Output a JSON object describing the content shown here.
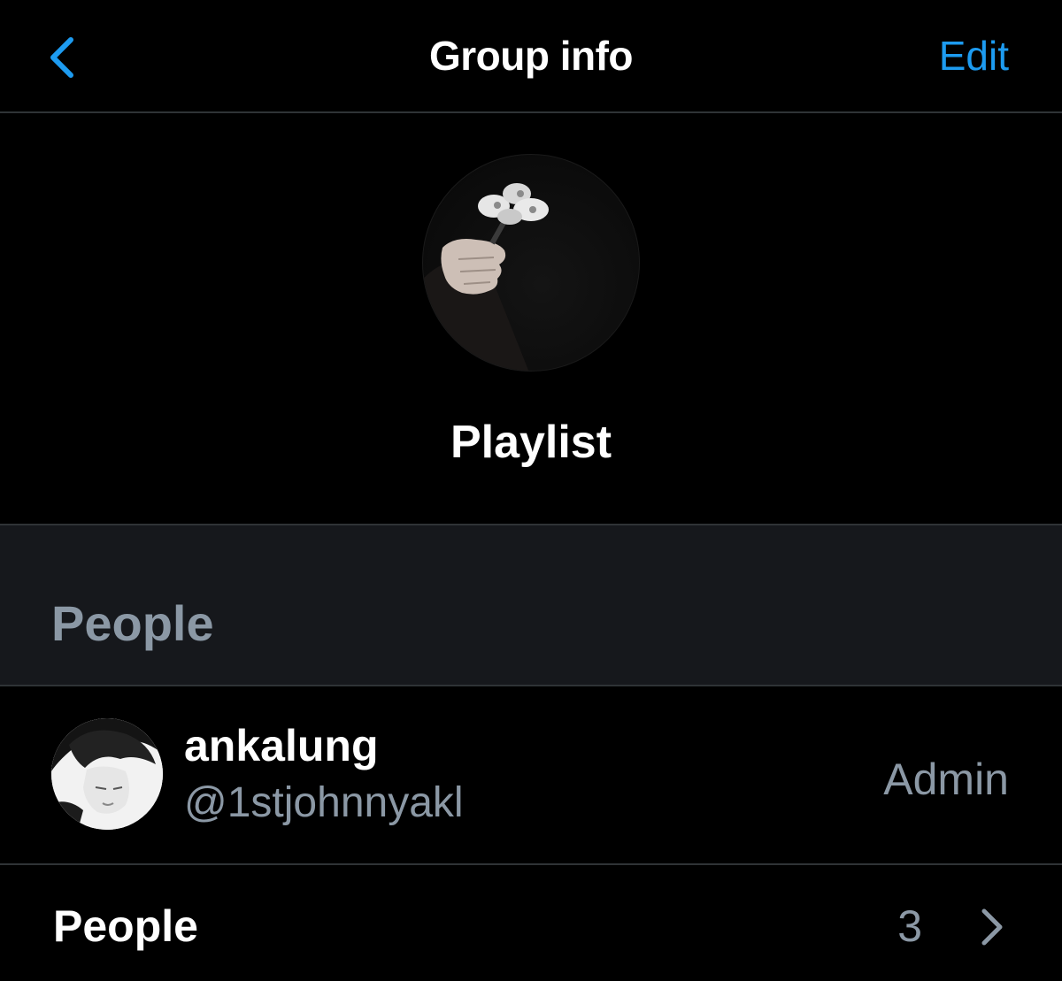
{
  "nav": {
    "back_icon": "chevron-left-icon",
    "title": "Group info",
    "edit_label": "Edit"
  },
  "group": {
    "name": "Playlist"
  },
  "people_section": {
    "title": "People"
  },
  "members": [
    {
      "display_name": "ankalung",
      "handle": "@1stjohnnyakl",
      "role": "Admin"
    }
  ],
  "people_row": {
    "label": "People",
    "count": "3",
    "chevron_icon": "chevron-right-icon"
  },
  "colors": {
    "accent": "#1d9bf0",
    "background": "#000000",
    "section_background": "#16181c",
    "secondary_text": "#8b98a5",
    "divider": "#2f3336"
  }
}
